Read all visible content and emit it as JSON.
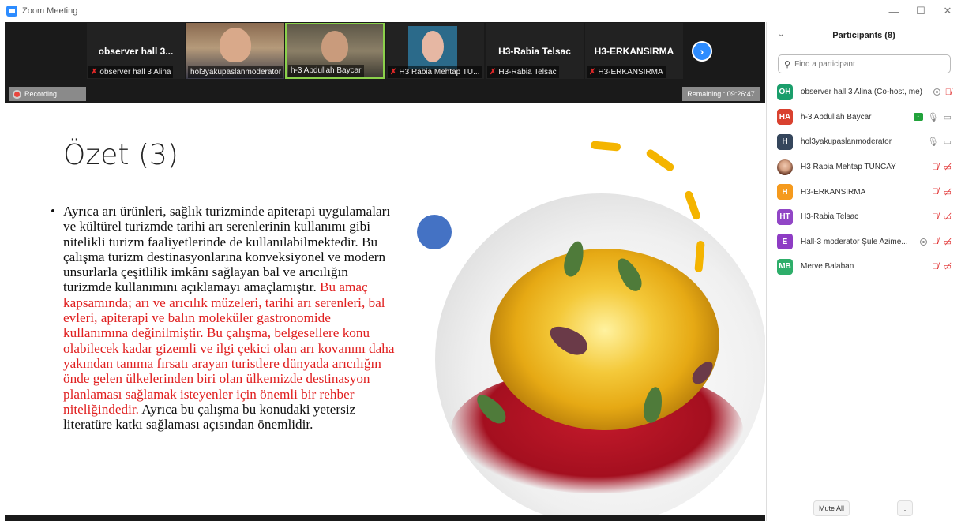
{
  "window": {
    "title": "Zoom Meeting",
    "minimize": "—",
    "maximize": "☐",
    "close": "✕"
  },
  "video_strip": {
    "tiles": [
      {
        "big_name": "observer hall 3...",
        "label": "observer hall 3 Alina",
        "muted": true
      },
      {
        "big_name": "",
        "label": "hol3yakupaslanmoderator",
        "muted": false
      },
      {
        "big_name": "",
        "label": "h-3 Abdullah Baycar",
        "muted": false
      },
      {
        "big_name": "",
        "label": "H3 Rabia Mehtap TU...",
        "muted": true
      },
      {
        "big_name": "H3-Rabia Telsac",
        "label": "H3-Rabia Telsac",
        "muted": true
      },
      {
        "big_name": "H3-ERKANSIRMA",
        "label": "H3-ERKANSIRMA",
        "muted": true
      }
    ],
    "next_icon": "›"
  },
  "status": {
    "recording": "Recording...",
    "remaining": "Remaining : 09:26:47"
  },
  "slide": {
    "title": "Özet (3)",
    "bullet": "•",
    "text_black_1": "Ayrıca arı ürünleri, sağlık turizminde apiterapi uygulamaları ve kültürel turizmde tarihi arı serenlerinin kullanımı gibi nitelikli turizm faaliyetlerinde de kullanılabilmektedir. Bu çalışma turizm destinasyonlarına konveksiyonel ve modern unsurlarla çeşitlilik imkânı sağlayan bal ve arıcılığın turizmde kullanımını açıklamayı amaçlamıştır. ",
    "text_red": "Bu amaç kapsamında; arı ve arıcılık müzeleri, tarihi arı serenleri, bal evleri, apiterapi ve balın moleküler gastronomide kullanımına değinilmiştir. Bu çalışma, belgesellere konu olabilecek kadar gizemli ve ilgi çekici olan arı kovanını daha yakından tanıma fırsatı arayan turistlere dünyada arıcılığın önde gelen ülkelerinden biri olan ülkemizde destinasyon planlaması sağlamak isteyenler için önemli bir rehber niteliğindedir.",
    "text_black_2": " Ayrıca bu çalışma bu konudaki yetersiz literatüre katkı sağlaması açısından önemlidir.",
    "accent_blue": "#4472c4",
    "accent_yellow": "#f4b400",
    "highlight_red": "#e02020"
  },
  "participants": {
    "title": "Participants (8)",
    "collapse_icon": "⌄",
    "search_placeholder": "Find a participant",
    "list": [
      {
        "initials": "OH",
        "color": "#1a9e6b",
        "name": "observer hall 3 Alina (Co-host, me)",
        "rec": true,
        "mic": "off",
        "cam": "none",
        "share": false
      },
      {
        "initials": "HA",
        "color": "#d9412f",
        "name": "h-3 Abdullah Baycar",
        "rec": false,
        "mic": "on",
        "cam": "on",
        "share": true
      },
      {
        "initials": "H",
        "color": "#35465c",
        "name": "hol3yakupaslanmoderator",
        "rec": false,
        "mic": "on",
        "cam": "on",
        "share": false
      },
      {
        "initials": "",
        "color": "photo",
        "name": "H3 Rabia Mehtap TUNCAY",
        "rec": false,
        "mic": "off",
        "cam": "off",
        "share": false
      },
      {
        "initials": "H",
        "color": "#f59a1d",
        "name": "H3-ERKANSIRMA",
        "rec": false,
        "mic": "off",
        "cam": "off",
        "share": false
      },
      {
        "initials": "HT",
        "color": "#9146c6",
        "name": "H3-Rabia Telsac",
        "rec": false,
        "mic": "off",
        "cam": "off",
        "share": false
      },
      {
        "initials": "E",
        "color": "#8e3cc4",
        "name": "Hall-3 moderator Şule Azime...",
        "rec": true,
        "mic": "off",
        "cam": "off",
        "share": false
      },
      {
        "initials": "MB",
        "color": "#2eae6a",
        "name": "Merve Balaban",
        "rec": false,
        "mic": "off",
        "cam": "off",
        "share": false
      }
    ],
    "mute_all": "Mute All",
    "more": "..."
  }
}
